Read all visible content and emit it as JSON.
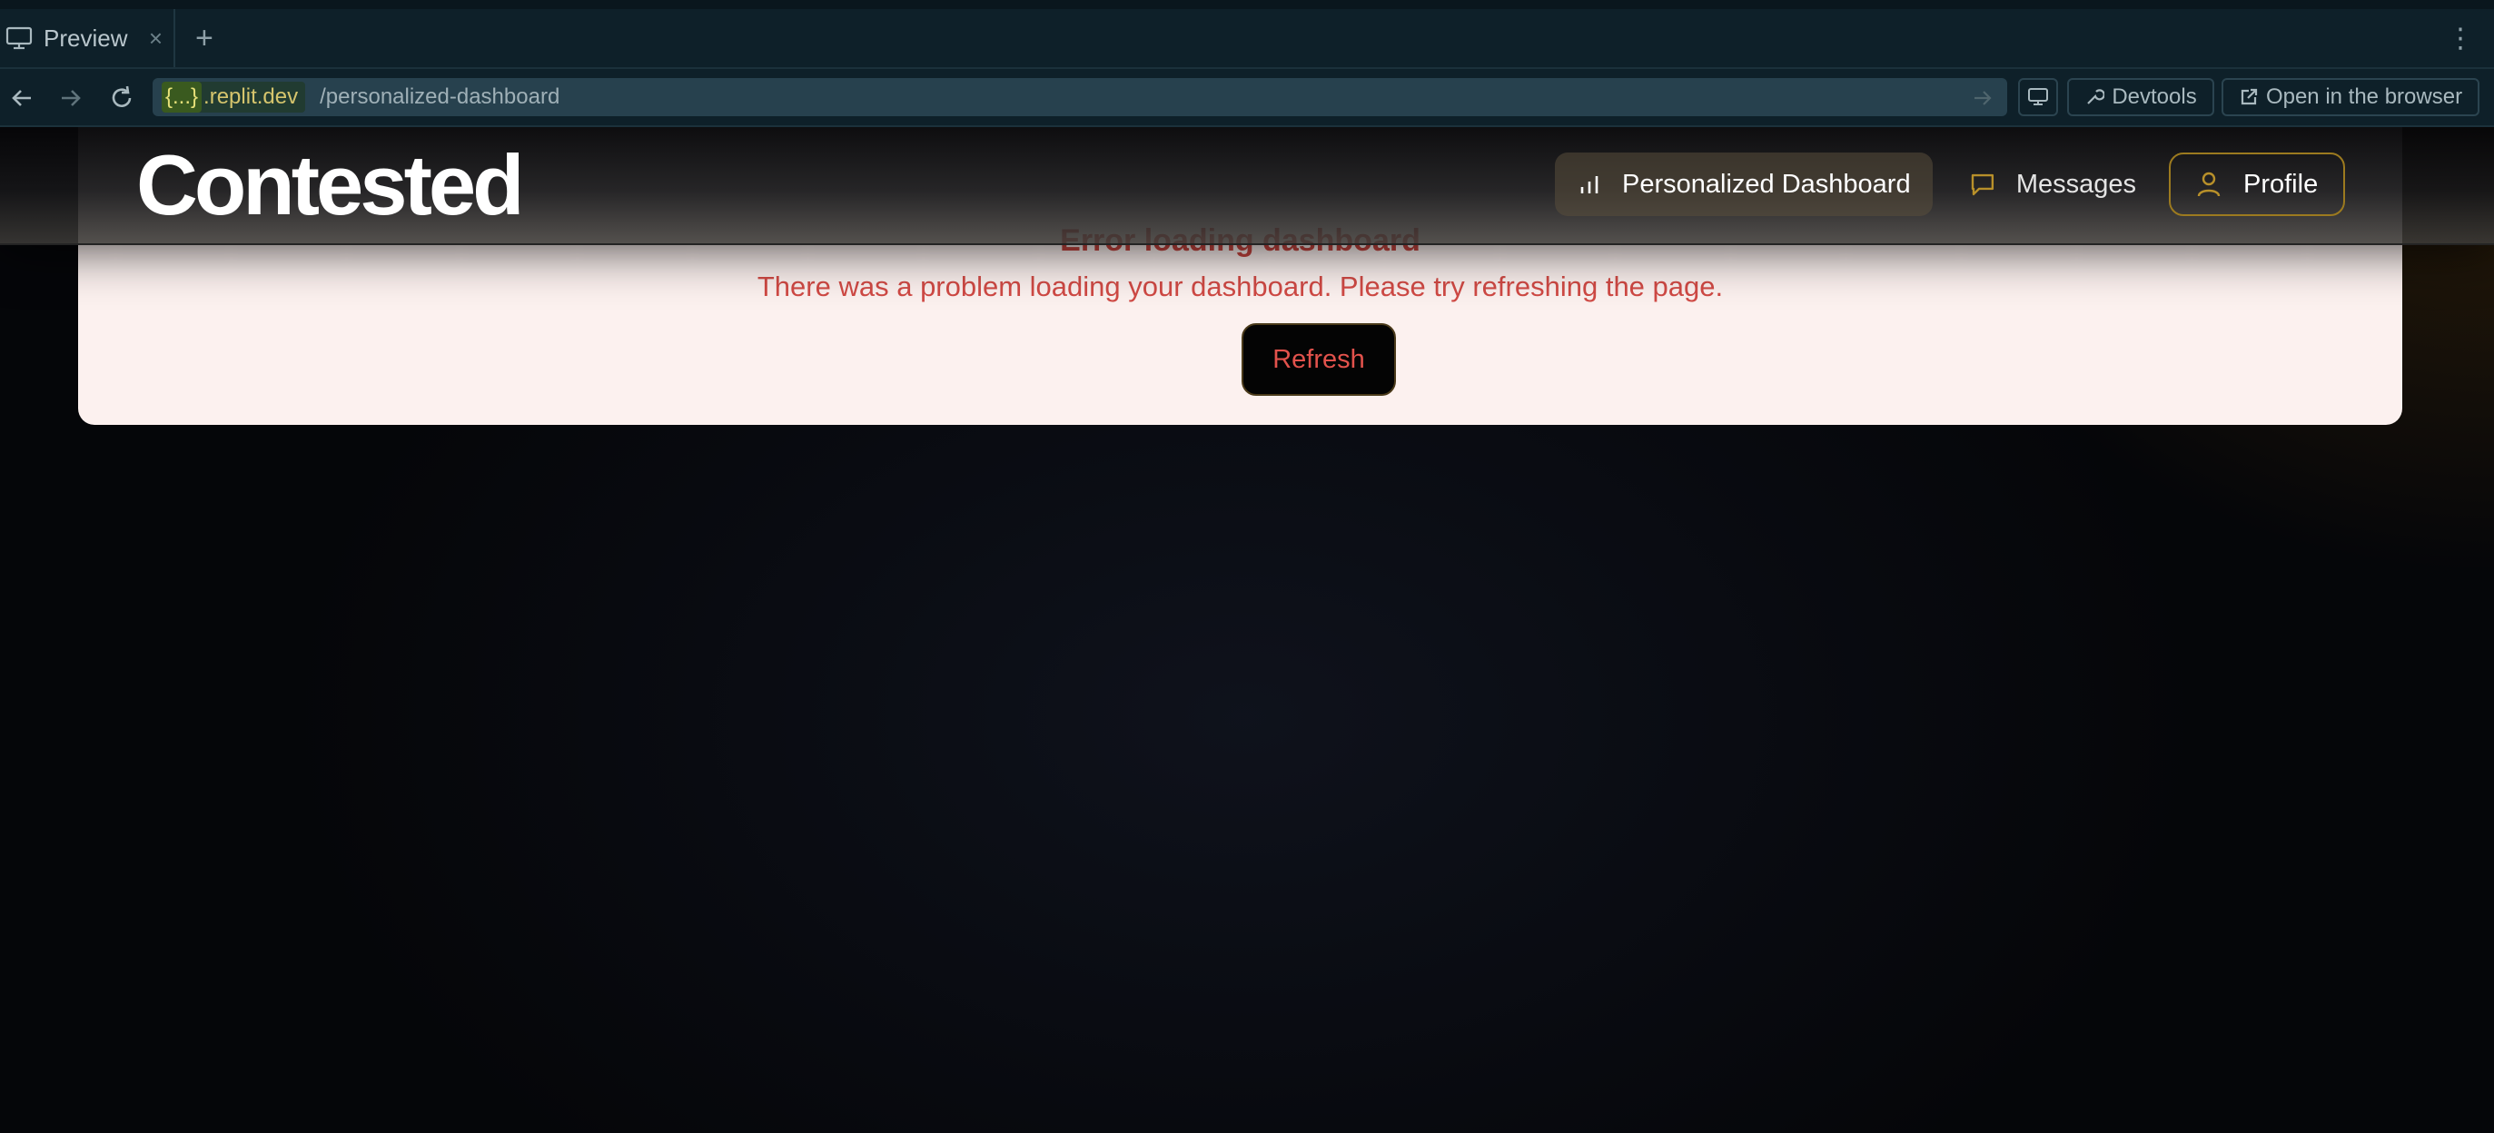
{
  "browser": {
    "tab": {
      "title": "Preview",
      "close": "×"
    },
    "new_tab": "+",
    "menu": "⋮",
    "url": {
      "host_placeholder": "{...}",
      "host_domain": ".replit.dev",
      "path": "/personalized-dashboard"
    },
    "buttons": {
      "devtools": "Devtools",
      "open_browser": "Open in the browser"
    }
  },
  "header": {
    "logo": "Contested",
    "nav": [
      {
        "label": "Personalized Dashboard",
        "active": true
      },
      {
        "label": "Messages"
      },
      {
        "label": "Profile"
      }
    ]
  },
  "error": {
    "title": "Error loading dashboard",
    "message": "There was a problem loading your dashboard. Please try refreshing the page.",
    "button": "Refresh"
  },
  "colors": {
    "accent_gold": "#9c7a1f",
    "error_red": "#d14a45",
    "error_background": "#fcf1ef",
    "app_background": "#050609"
  }
}
